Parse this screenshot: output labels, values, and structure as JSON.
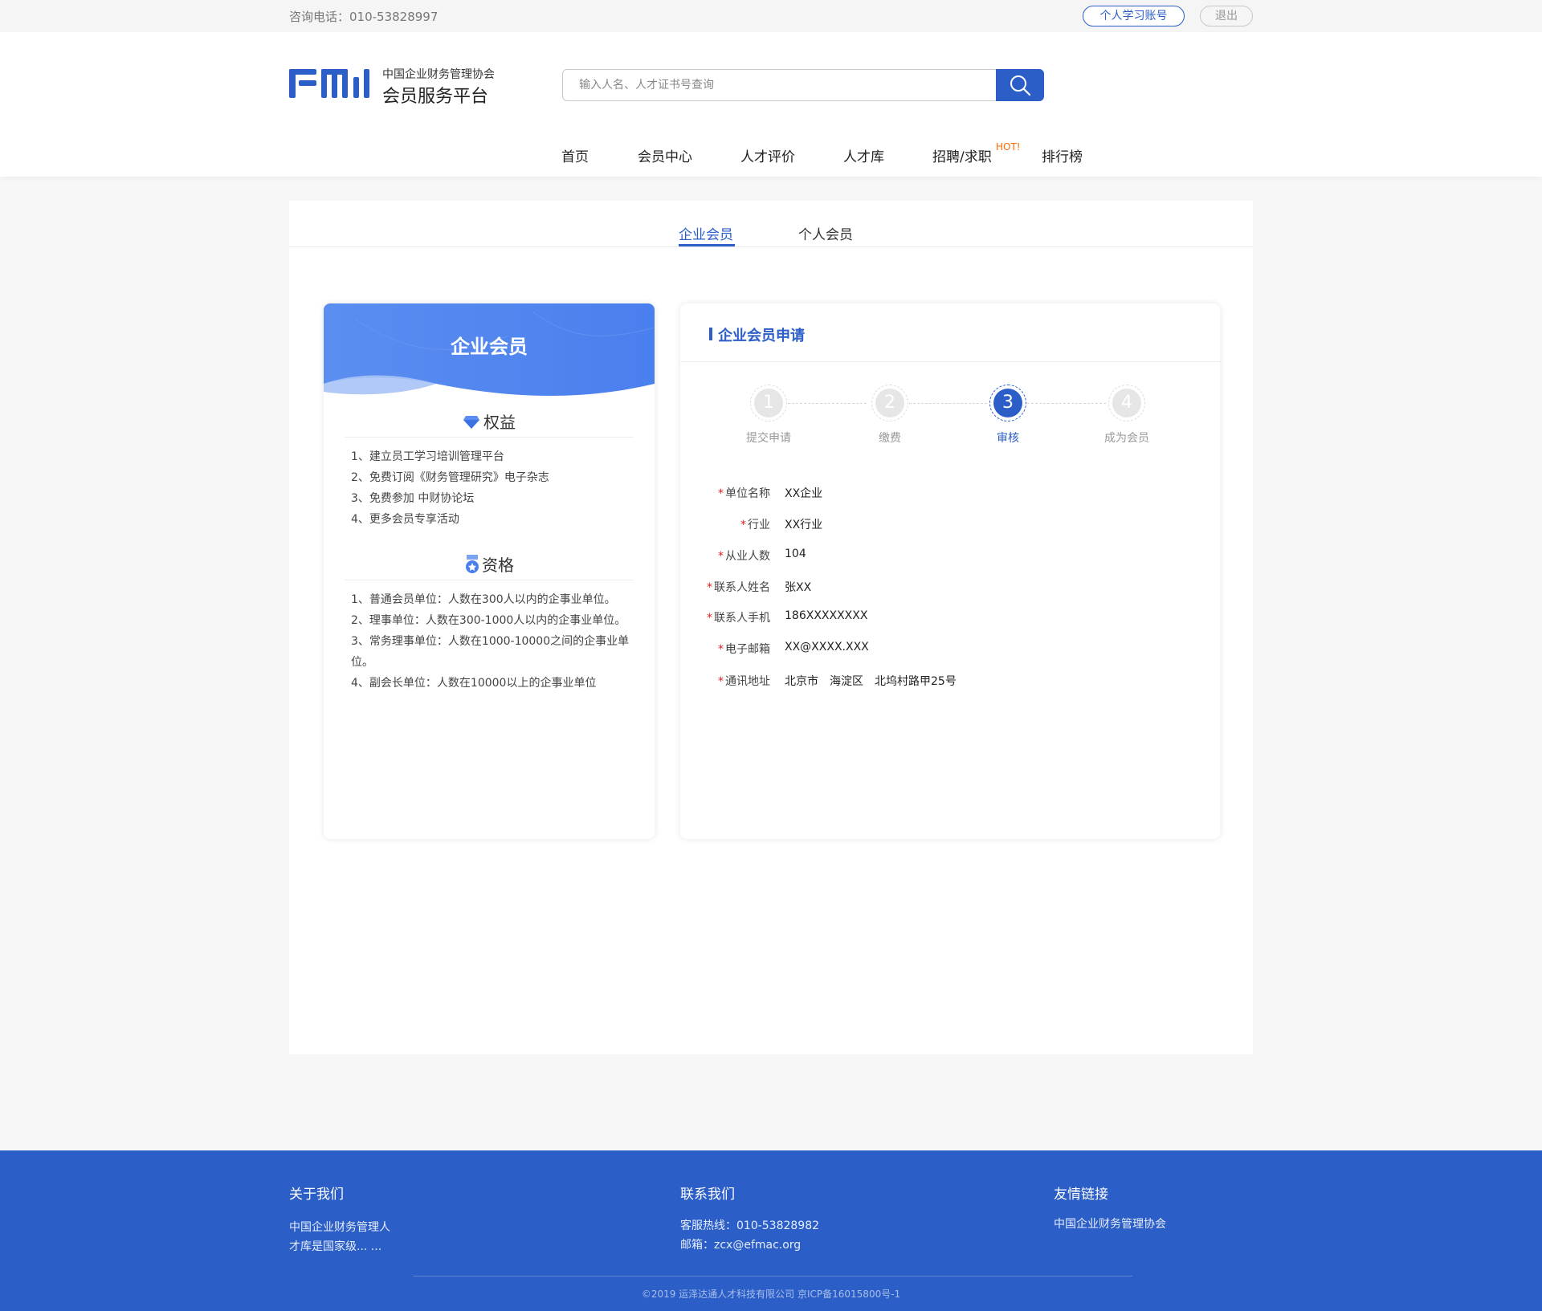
{
  "topbar": {
    "phone": "咨询电话：010-53828997",
    "account_label": "个人学习账号",
    "logout_label": "退出"
  },
  "header": {
    "logo_org": "中国企业财务管理协会",
    "logo_title": "会员服务平台",
    "search_placeholder": "输入人名、人才证书号查询"
  },
  "nav": {
    "items": [
      "首页",
      "会员中心",
      "人才评价",
      "人才库",
      "招聘/求职",
      "排行榜"
    ],
    "hot_label": "HOT!"
  },
  "tabs": {
    "items": [
      "企业会员",
      "个人会员"
    ],
    "active": 0
  },
  "left_card": {
    "title": "企业会员",
    "benefits_title": "权益",
    "benefits": [
      "1、建立员工学习培训管理平台",
      "2、免费订阅《财务管理研究》电子杂志",
      "3、免费参加 中财协论坛",
      "4、更多会员专享活动"
    ],
    "qualification_title": "资格",
    "qualifications": [
      "1、普通会员单位：人数在300人以内的企事业单位。",
      "2、理事单位：人数在300-1000人以内的企事业单位。",
      "3、常务理事单位：人数在1000-10000之间的企事业单位。",
      "4、副会长单位：人数在10000以上的企事业单位"
    ]
  },
  "right_card": {
    "title": "企业会员申请",
    "steps": [
      {
        "num": "1",
        "label": "提交申请"
      },
      {
        "num": "2",
        "label": "缴费"
      },
      {
        "num": "3",
        "label": "审核"
      },
      {
        "num": "4",
        "label": "成为会员"
      }
    ],
    "active_step": 3,
    "form": [
      {
        "label": "单位名称",
        "value": "XX企业"
      },
      {
        "label": "行业",
        "value": "XX行业"
      },
      {
        "label": "从业人数",
        "value": "104"
      },
      {
        "label": "联系人姓名",
        "value": "张XX"
      },
      {
        "label": "联系人手机",
        "value": "186XXXXXXXX"
      },
      {
        "label": "电子邮箱",
        "value": "XX@XXXX.XXX"
      },
      {
        "label": "通讯地址",
        "value": "北京市　海淀区　北坞村路甲25号"
      }
    ]
  },
  "footer": {
    "about_title": "关于我们",
    "about_text_1": "中国企业财务管理人",
    "about_text_2": "才库是国家级... ...",
    "contact_title": "联系我们",
    "contact_phone": "客服热线：010-53828982",
    "contact_email": "邮箱：zcx@efmac.org",
    "links_title": "友情链接",
    "links_item": "中国企业财务管理协会",
    "copyright": "©2019 运泽达通人才科技有限公司  京ICP备16015800号-1"
  },
  "colors": {
    "primary": "#2b5ec7",
    "hot": "#ff6a00",
    "required": "#e02020"
  }
}
